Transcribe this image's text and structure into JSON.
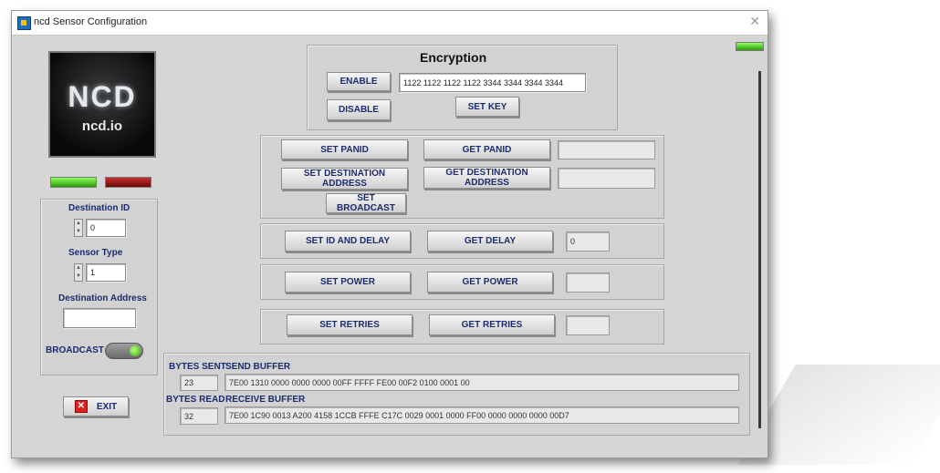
{
  "window": {
    "title": "ncd Sensor Configuration",
    "close": "✕"
  },
  "logo": {
    "mark": "NCD",
    "site": "ncd.io"
  },
  "status_leds": {
    "left": "#3cc016",
    "right": "#9a1010",
    "top_right": "#3cc016"
  },
  "sidebar": {
    "destination_id": {
      "label": "Destination ID",
      "value": "0"
    },
    "sensor_type": {
      "label": "Sensor Type",
      "value": "1"
    },
    "destination_address": {
      "label": "Destination Address",
      "value": ""
    },
    "broadcast": {
      "label": "BROADCAST",
      "state": "on"
    },
    "exit_label": "EXIT"
  },
  "encryption": {
    "title": "Encryption",
    "enable": "ENABLE",
    "disable": "DISABLE",
    "key_value": "1122 1122 1122 1122 3344 3344 3344 3344",
    "set_key": "SET KEY"
  },
  "network": {
    "set_panid": "SET PANID",
    "get_panid": "GET PANID",
    "panid_value": "",
    "set_dest": "SET DESTINATION ADDRESS",
    "get_dest": "GET DESTINATION ADDRESS",
    "dest_value": "",
    "set_broadcast": "SET BROADCAST"
  },
  "delay": {
    "set": "SET ID AND DELAY",
    "get": "GET DELAY",
    "value": "0"
  },
  "power": {
    "set": "SET POWER",
    "get": "GET POWER",
    "value": ""
  },
  "retries": {
    "set": "SET RETRIES",
    "get": "GET RETRIES",
    "value": ""
  },
  "buffers": {
    "bytes_sent_label": "BYTES SENT",
    "bytes_sent": "23",
    "send_label": "SEND BUFFER",
    "send_value": "7E00 1310 0000 0000 0000 00FF FFFF FE00 00F2 0100 0001 00",
    "bytes_read_label": "BYTES READ",
    "bytes_read": "32",
    "receive_label": "RECEIVE BUFFER",
    "receive_value": "7E00 1C90 0013 A200 4158 1CCB FFFE C17C 0029 0001 0000 FF00 0000 0000 0000 00D7"
  }
}
